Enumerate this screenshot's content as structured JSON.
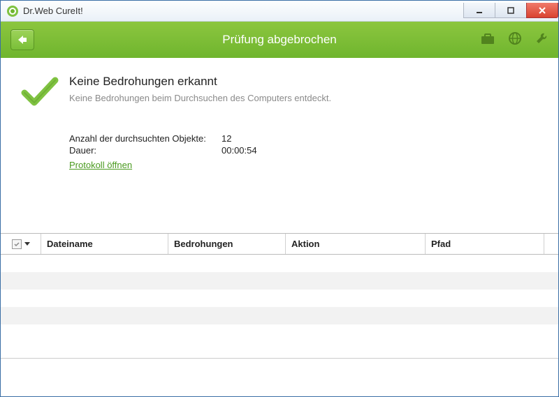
{
  "window": {
    "title": "Dr.Web CureIt!"
  },
  "toolbar": {
    "title": "Prüfung abgebrochen"
  },
  "result": {
    "heading": "Keine Bedrohungen erkannt",
    "subtext": "Keine Bedrohungen beim Durchsuchen des Computers entdeckt."
  },
  "stats": {
    "objects_label": "Anzahl der durchsuchten Objekte:",
    "objects_value": "12",
    "duration_label": "Dauer:",
    "duration_value": "00:00:54",
    "protocol_link": "Protokoll öffnen"
  },
  "table": {
    "columns": {
      "filename": "Dateiname",
      "threat": "Bedrohungen",
      "action": "Aktion",
      "path": "Pfad"
    }
  }
}
